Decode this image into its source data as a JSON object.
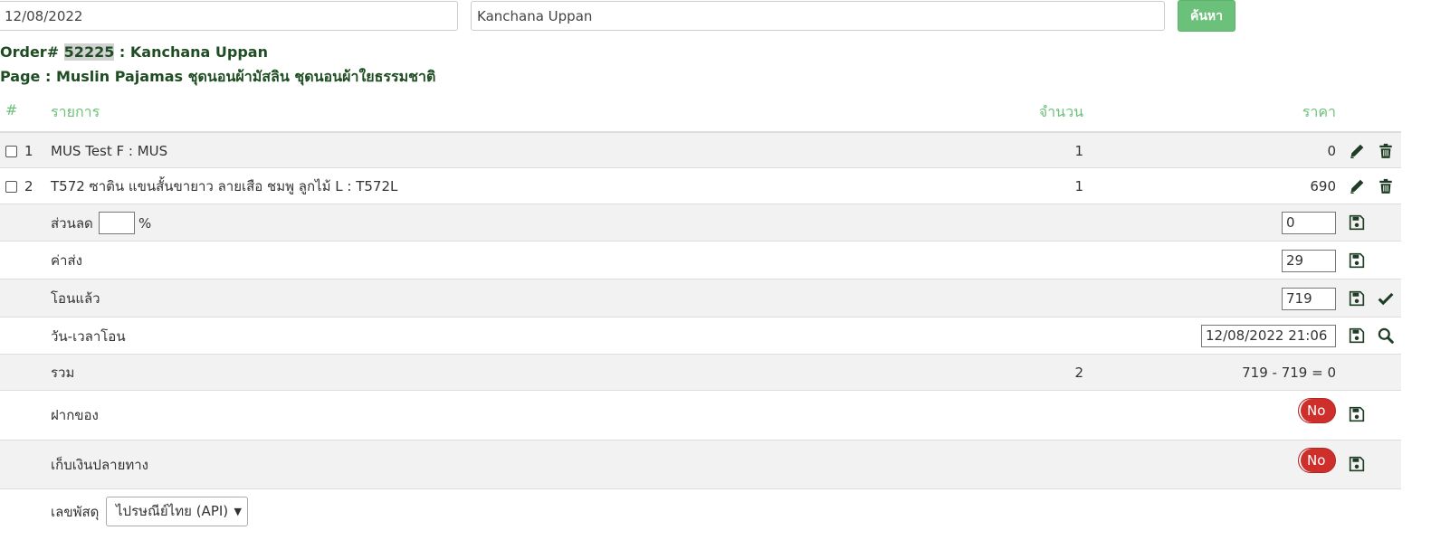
{
  "search": {
    "date_value": "12/08/2022",
    "name_value": "Kanchana Uppan",
    "button_label": "ค้นหา"
  },
  "order": {
    "prefix": "Order#",
    "number": "52225",
    "customer": ": Kanchana Uppan",
    "page_line": "Page : Muslin Pajamas ชุดนอนผ้ามัสลิน ชุดนอนผ้าใยธรรมชาติ"
  },
  "table": {
    "headers": {
      "index": "#",
      "item": "รายการ",
      "qty": "จำนวน",
      "price": "ราคา"
    },
    "items": [
      {
        "index": "1",
        "name": "MUS Test F : MUS",
        "qty": "1",
        "price": "0"
      },
      {
        "index": "2",
        "name": "T572 ซาติน แขนสั้นขายาว ลายเสือ ชมพู ลูกไม้ L : T572L",
        "qty": "1",
        "price": "690"
      }
    ]
  },
  "discount": {
    "label": "ส่วนลด",
    "percent_value": "",
    "percent_sign": "%",
    "amount": "0"
  },
  "shipping": {
    "label": "ค่าส่ง",
    "amount": "29"
  },
  "transferred": {
    "label": "โอนแล้ว",
    "amount": "719"
  },
  "transfer_time": {
    "label": "วัน-เวลาโอน",
    "value": "12/08/2022 21:06"
  },
  "total": {
    "label": "รวม",
    "qty": "2",
    "formula": "719 - 719 = 0"
  },
  "deposit": {
    "label": "ฝากของ",
    "toggle": "No"
  },
  "cod": {
    "label": "เก็บเงินปลายทาง",
    "toggle": "No"
  },
  "tracking": {
    "label": "เลขพัสดุ",
    "selected": "ไปรษณีย์ไทย (API)"
  },
  "colors": {
    "accent_green": "#6cc17a",
    "heading_green": "#1f4d23",
    "toggle_red": "#cf2f2b",
    "icon_dark": "#1f3d24"
  }
}
